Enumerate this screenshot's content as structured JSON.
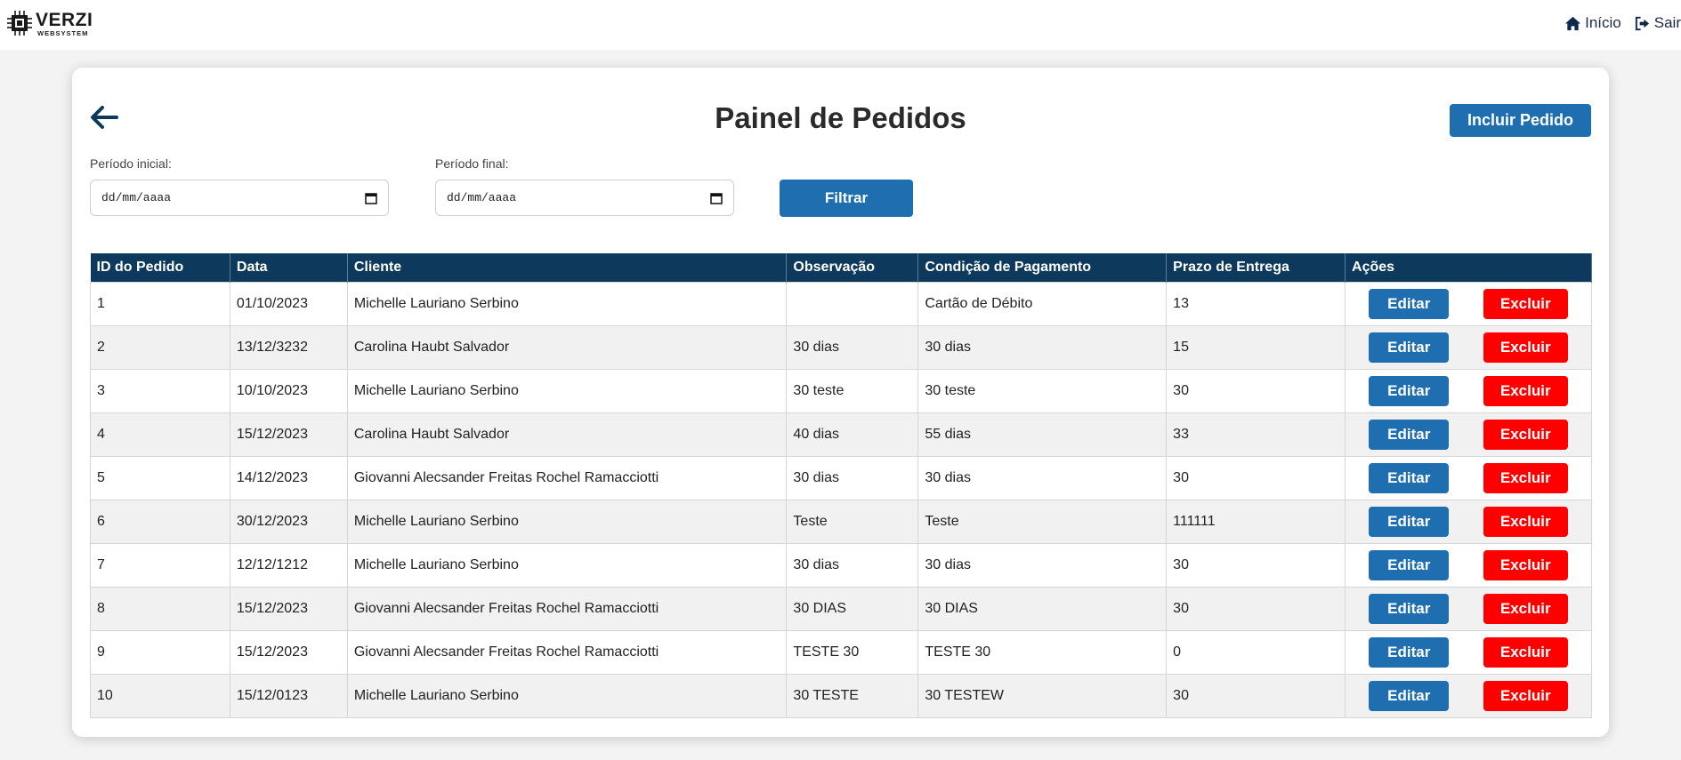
{
  "app": {
    "logo_name": "VERZI",
    "logo_sub": "WEBSYSTEM"
  },
  "nav": {
    "home_label": "Início",
    "logout_label": "Sair"
  },
  "page": {
    "title": "Painel de Pedidos",
    "add_button": "Incluir Pedido"
  },
  "filters": {
    "start_label": "Período inicial:",
    "start_value": "dd/mm/aaaa",
    "end_label": "Período final:",
    "end_value": "dd/mm/aaaa",
    "filter_button": "Filtrar"
  },
  "table": {
    "columns": [
      "ID do Pedido",
      "Data",
      "Cliente",
      "Observação",
      "Condição de Pagamento",
      "Prazo de Entrega",
      "Ações"
    ],
    "edit_label": "Editar",
    "delete_label": "Excluir",
    "rows": [
      {
        "id": "1",
        "date": "01/10/2023",
        "client": "Michelle Lauriano Serbino",
        "obs": "",
        "payment": "Cartão de Débito",
        "delivery": "13"
      },
      {
        "id": "2",
        "date": "13/12/3232",
        "client": "Carolina Haubt Salvador",
        "obs": "30 dias",
        "payment": "30 dias",
        "delivery": "15"
      },
      {
        "id": "3",
        "date": "10/10/2023",
        "client": "Michelle Lauriano Serbino",
        "obs": "30 teste",
        "payment": "30 teste",
        "delivery": "30"
      },
      {
        "id": "4",
        "date": "15/12/2023",
        "client": "Carolina Haubt Salvador",
        "obs": "40 dias",
        "payment": "55 dias",
        "delivery": "33"
      },
      {
        "id": "5",
        "date": "14/12/2023",
        "client": "Giovanni Alecsander Freitas Rochel Ramacciotti",
        "obs": "30 dias",
        "payment": "30 dias",
        "delivery": "30"
      },
      {
        "id": "6",
        "date": "30/12/2023",
        "client": "Michelle Lauriano Serbino",
        "obs": "Teste",
        "payment": "Teste",
        "delivery": "111111"
      },
      {
        "id": "7",
        "date": "12/12/1212",
        "client": "Michelle Lauriano Serbino",
        "obs": "30 dias",
        "payment": "30 dias",
        "delivery": "30"
      },
      {
        "id": "8",
        "date": "15/12/2023",
        "client": "Giovanni Alecsander Freitas Rochel Ramacciotti",
        "obs": "30 DIAS",
        "payment": "30 DIAS",
        "delivery": "30"
      },
      {
        "id": "9",
        "date": "15/12/2023",
        "client": "Giovanni Alecsander Freitas Rochel Ramacciotti",
        "obs": "TESTE 30",
        "payment": "TESTE 30",
        "delivery": "0"
      },
      {
        "id": "10",
        "date": "15/12/0123",
        "client": "Michelle Lauriano Serbino",
        "obs": "30 TESTE",
        "payment": "30 TESTEW",
        "delivery": "30"
      }
    ]
  },
  "icons": {
    "logo": "chip-icon",
    "home": "home-icon",
    "logout": "logout-icon",
    "back": "arrow-left-icon",
    "calendar": "calendar-icon"
  },
  "colors": {
    "primary": "#1f6fb0",
    "header": "#0d3a5c",
    "danger": "#ff0000",
    "background": "#f3f3f3"
  }
}
